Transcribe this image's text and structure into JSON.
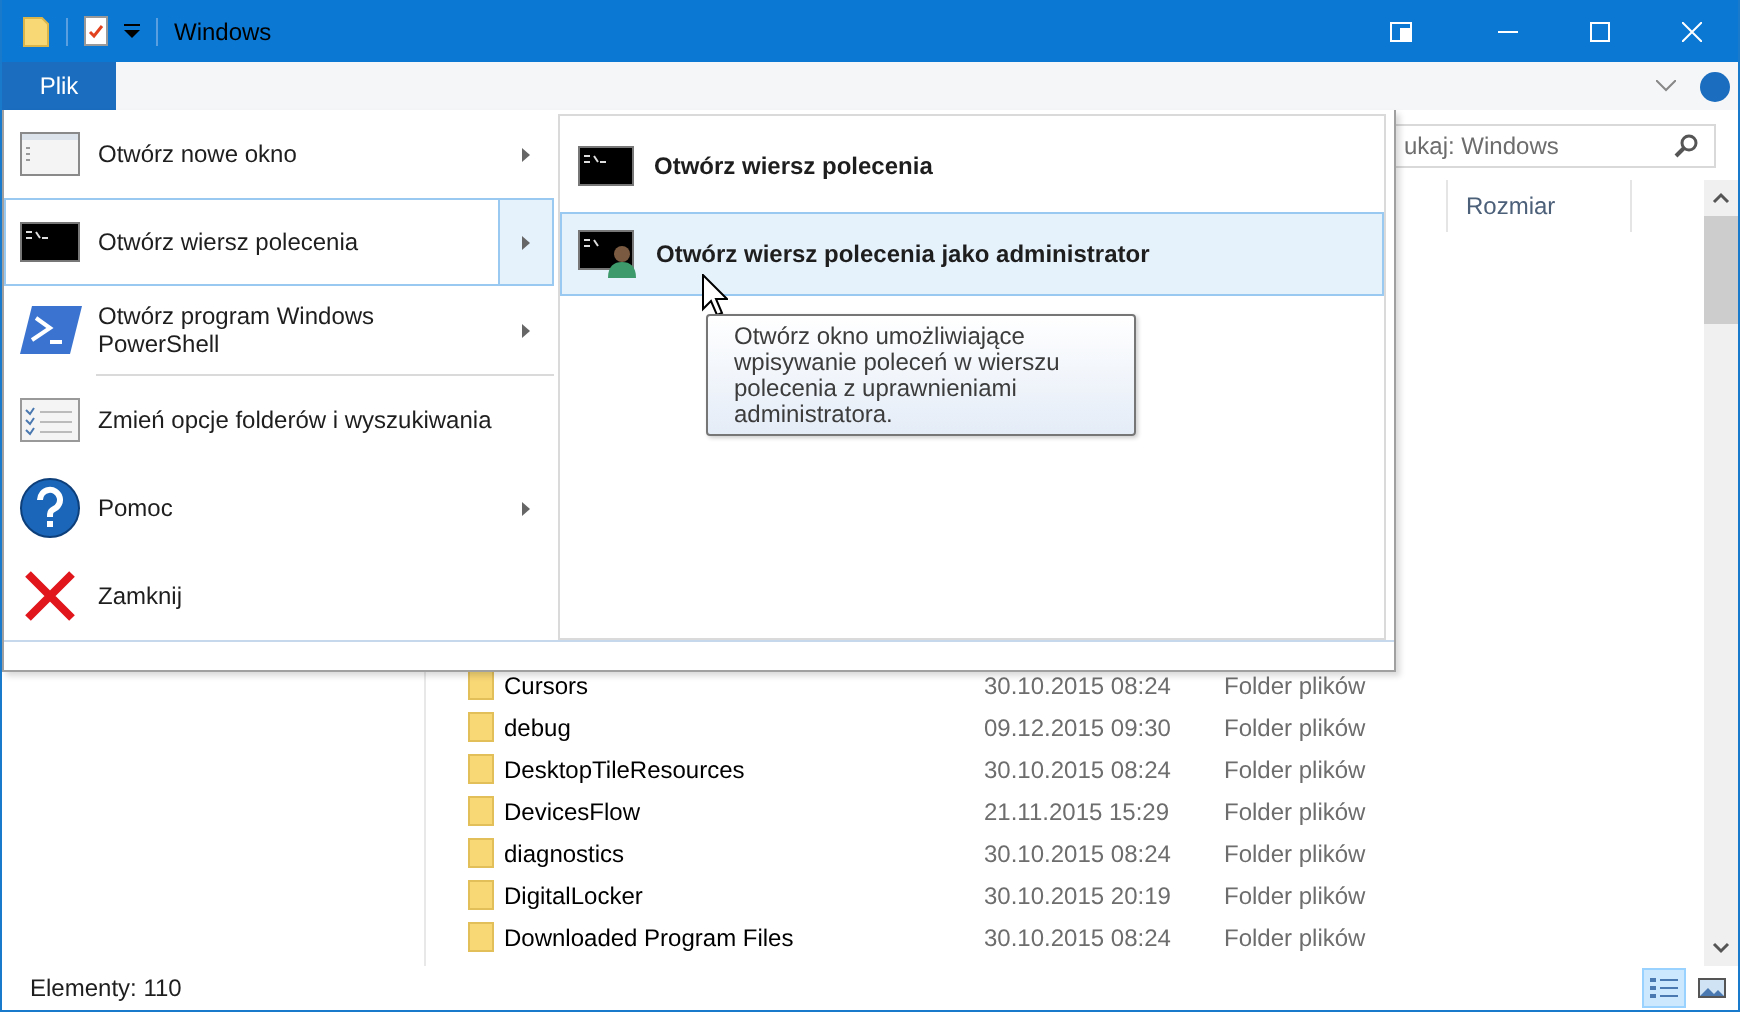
{
  "title_bar": {
    "title": "Windows"
  },
  "ribbon_tabs": [
    {
      "label": "Plik",
      "selected": true
    }
  ],
  "search": {
    "placeholder": "ukaj: Windows"
  },
  "file_list": {
    "columns": [
      {
        "label": "Rozmiar"
      }
    ],
    "rows": [
      {
        "name": "Cursors",
        "date": "30.10.2015 08:24",
        "type": "Folder plików"
      },
      {
        "name": "debug",
        "date": "09.12.2015 09:30",
        "type": "Folder plików"
      },
      {
        "name": "DesktopTileResources",
        "date": "30.10.2015 08:24",
        "type": "Folder plików"
      },
      {
        "name": "DevicesFlow",
        "date": "21.11.2015 15:29",
        "type": "Folder plików"
      },
      {
        "name": "diagnostics",
        "date": "30.10.2015 08:24",
        "type": "Folder plików"
      },
      {
        "name": "DigitalLocker",
        "date": "30.10.2015 20:19",
        "type": "Folder plików"
      },
      {
        "name": "Downloaded Program Files",
        "date": "30.10.2015 08:24",
        "type": "Folder plików"
      }
    ]
  },
  "status_bar": {
    "item_count": "Elementy: 110"
  },
  "view_buttons": [
    {
      "kind": "details",
      "selected": true
    },
    {
      "kind": "tiles",
      "selected": false
    }
  ],
  "file_menu": {
    "items": [
      {
        "label": "Otwórz nowe okno",
        "has_submenu": true,
        "selected": false,
        "separator_after": false
      },
      {
        "label": "Otwórz wiersz polecenia",
        "has_submenu": true,
        "selected": true,
        "separator_after": false
      },
      {
        "label": "Otwórz program Windows PowerShell",
        "has_submenu": true,
        "selected": false,
        "separator_after": true
      },
      {
        "label": "Zmień opcje folderów i wyszukiwania",
        "has_submenu": false,
        "selected": false,
        "separator_after": false
      },
      {
        "label": "Pomoc",
        "has_submenu": true,
        "selected": false,
        "separator_after": false
      },
      {
        "label": "Zamknij",
        "has_submenu": false,
        "selected": false,
        "separator_after": false
      }
    ],
    "submenu": [
      {
        "label": "Otwórz wiersz polecenia",
        "selected": false,
        "bold": true
      },
      {
        "label": "Otwórz wiersz polecenia jako administrator",
        "selected": true,
        "bold": true
      }
    ]
  },
  "tooltip": {
    "text": "Otwórz okno umożliwiające wpisywanie poleceń w wierszu polecenia z uprawnieniami administratora."
  }
}
